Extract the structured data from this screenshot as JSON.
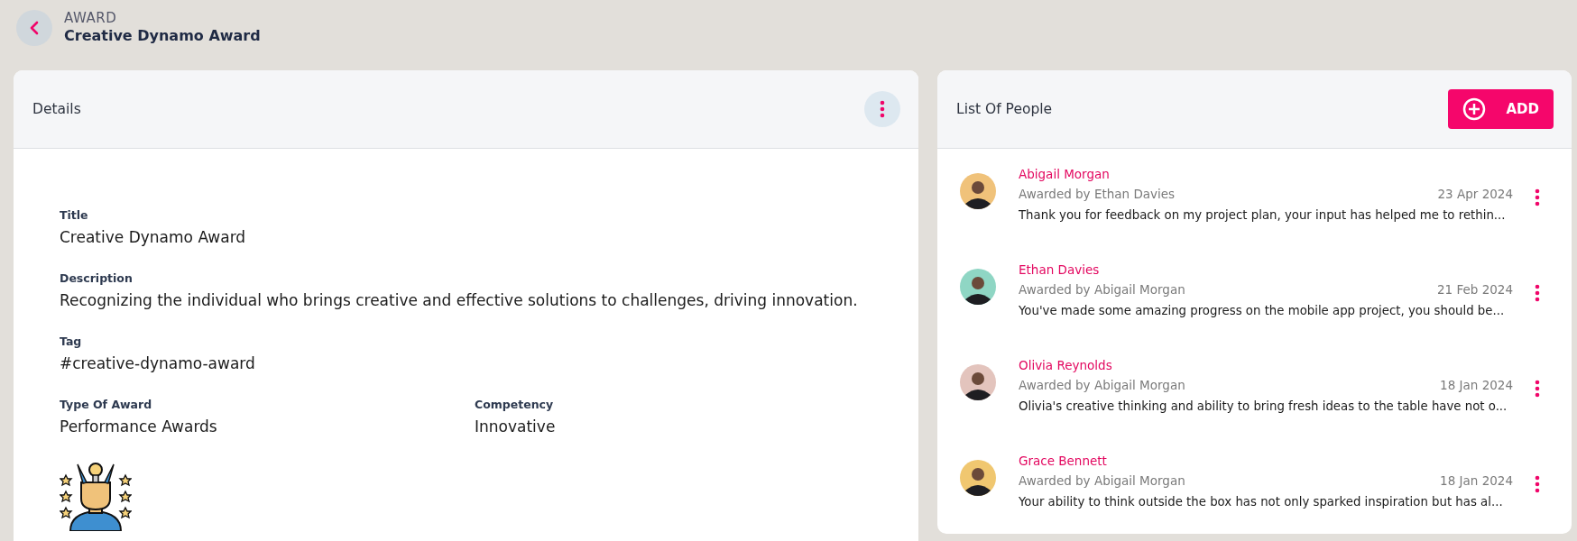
{
  "header": {
    "kicker": "AWARD",
    "title": "Creative Dynamo Award"
  },
  "details": {
    "heading": "Details",
    "fields": [
      {
        "label": "Title",
        "value": "Creative Dynamo Award"
      },
      {
        "label": "Description",
        "value": "Recognizing the individual who brings creative and effective solutions to challenges, driving innovation."
      },
      {
        "label": "Tag",
        "value": "#creative-dynamo-award"
      }
    ],
    "pair": [
      {
        "label": "Type Of Award",
        "value": "Performance Awards"
      },
      {
        "label": "Competency",
        "value": "Innovative"
      }
    ]
  },
  "people": {
    "heading": "List Of People",
    "add_button": "ADD",
    "items": [
      {
        "name": "Abigail Morgan",
        "awarded_by": "Awarded by Ethan Davies",
        "date": "23 Apr 2024",
        "message": "Thank you for feedback on my project plan, your input has helped me to rethin...",
        "color": "#f0c27a"
      },
      {
        "name": "Ethan Davies",
        "awarded_by": "Awarded by Abigail Morgan",
        "date": "21 Feb 2024",
        "message": "You've made some amazing progress on the mobile app project, you should be...",
        "color": "#8fd6c4"
      },
      {
        "name": "Olivia Reynolds",
        "awarded_by": "Awarded by Abigail Morgan",
        "date": "18 Jan 2024",
        "message": "Olivia's creative thinking and ability to bring fresh ideas to the table have not o...",
        "color": "#e3c4bd"
      },
      {
        "name": "Grace Bennett",
        "awarded_by": "Awarded by Abigail Morgan",
        "date": "18 Jan 2024",
        "message": "Your ability to think outside the box has not only sparked inspiration but has al...",
        "color": "#f0c770"
      }
    ]
  }
}
